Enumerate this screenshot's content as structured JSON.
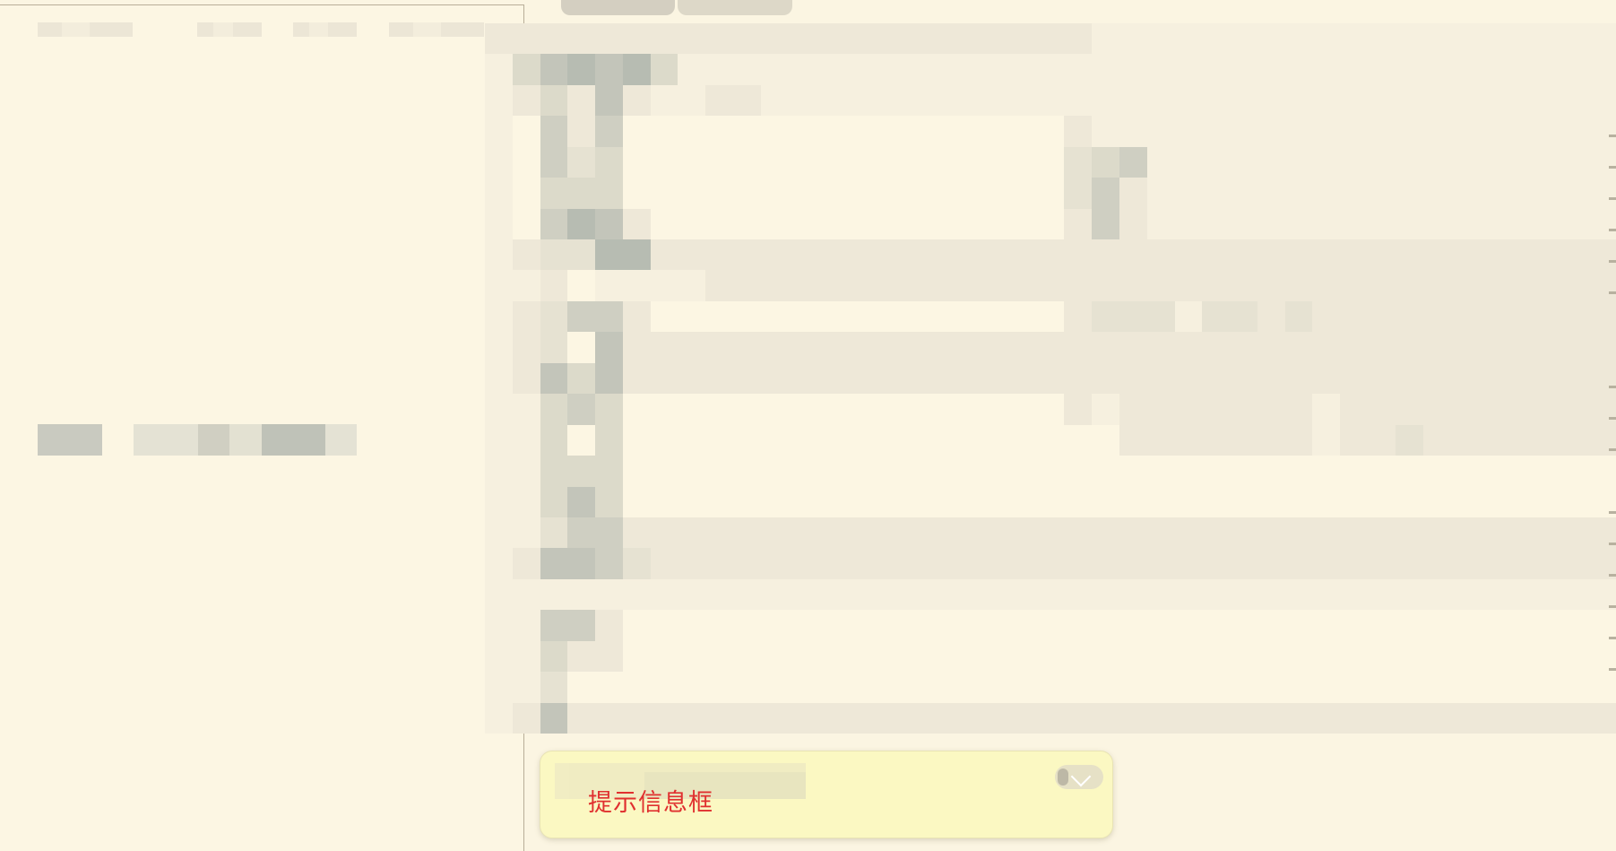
{
  "window": {
    "background": "#fbf5e2"
  },
  "tooltip": {
    "text": "提示信息框",
    "text_color": "#e0302f",
    "background": "#fbf8c2"
  },
  "icons": {
    "collapse": "chevron-down-icon"
  },
  "palette": [
    "#fcf6e3",
    "#f6f0df",
    "#eee8d8",
    "#e6e2d2",
    "#dcdaca",
    "#cfcfc2",
    "#c3c5ba",
    "#b7bcb2"
  ],
  "mosaic": [
    "22222222222222222222221111111111111111111",
    "14676741111111111111111111111111111111111",
    "12426211221111111111111111111111111111111",
    "10525000000000000000021111111111111111111",
    "10534000000000000000034511111111111111111",
    "10444000000000000000035211111111111111111",
    "10576200000000000000025211111111111111111",
    "12337722222222222222222222222222222222222",
    "11201111222222222222222222222222222222222",
    "12355200000000000000023331332322222222222",
    "12306222222222222222222222222222222222222",
    "12646222222222222222222222222222222222222",
    "11454000000000000000021222222212222222222",
    "11404000000000000000000222222212232222222",
    "11444000000000000000000000000000000000000",
    "11464000000000000000000000000000000000000",
    "11355222222222222222222222222222222222222",
    "12665322222222222222222222222222222222222",
    "11111111111111111111111111111111111111111",
    "11552000000000000000000000000000000000000",
    "11422000000000000000000000000000000000000",
    "11300000000000000000000000000000000000000",
    "12622222222222222222222222222222222222222"
  ]
}
